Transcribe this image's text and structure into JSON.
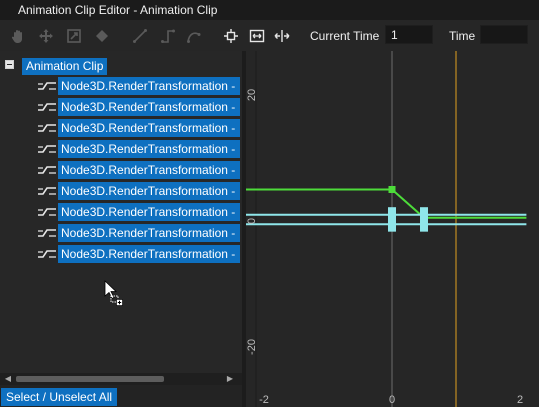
{
  "window": {
    "title": "Animation Clip Editor - Animation Clip"
  },
  "toolbar": {
    "tools": [
      {
        "icon": "hand-pan-icon",
        "enabled": false
      },
      {
        "icon": "move-icon",
        "enabled": false
      },
      {
        "icon": "scale-icon",
        "enabled": false
      },
      {
        "icon": "keyframe-diamond-icon",
        "enabled": false
      },
      {
        "icon": "linear-tangent-icon",
        "enabled": false
      },
      {
        "icon": "step-tangent-icon",
        "enabled": false
      },
      {
        "icon": "smooth-tangent-icon",
        "enabled": false
      },
      {
        "icon": "frame-selection-icon",
        "enabled": true
      },
      {
        "icon": "fit-all-icon",
        "enabled": true
      },
      {
        "icon": "fit-horizontal-icon",
        "enabled": true
      }
    ],
    "current_time_label": "Current Time",
    "current_time_value": "1",
    "time_label": "Time",
    "time_value": ""
  },
  "tree": {
    "root": {
      "label": "Animation Clip",
      "expanded": true
    },
    "items": [
      {
        "label": "Node3D.RenderTransformation - "
      },
      {
        "label": "Node3D.RenderTransformation - "
      },
      {
        "label": "Node3D.RenderTransformation - "
      },
      {
        "label": "Node3D.RenderTransformation - "
      },
      {
        "label": "Node3D.RenderTransformation - "
      },
      {
        "label": "Node3D.RenderTransformation - "
      },
      {
        "label": "Node3D.RenderTransformation - "
      },
      {
        "label": "Node3D.RenderTransformation - "
      },
      {
        "label": "Node3D.RenderTransformation - "
      }
    ]
  },
  "scrollbar": {
    "left_arrow": "◀",
    "right_arrow": "▶"
  },
  "footer": {
    "select_label": "Select / Unselect All"
  },
  "colors": {
    "selection": "#0e70c0",
    "green_curve": "#4ddc3a",
    "cyan_curve": "#8fe6ea",
    "current_time_line": "#e0a020",
    "zero_line": "#555555"
  },
  "chart_data": {
    "type": "line",
    "x_ticks": [
      "-2",
      "0",
      "2"
    ],
    "y_ticks": [
      "20",
      "0",
      "-20"
    ],
    "xlim": [
      -2.3,
      2.1
    ],
    "ylim": [
      -24,
      24
    ],
    "current_time": 1,
    "series": [
      {
        "color": "#4ddc3a",
        "points": [
          [
            -2.3,
            5
          ],
          [
            0,
            5
          ],
          [
            0.5,
            0.5
          ],
          [
            2.1,
            0.5
          ]
        ],
        "keys": [
          [
            0,
            5
          ]
        ]
      },
      {
        "color": "#8fe6ea",
        "points": [
          [
            -2.3,
            1
          ],
          [
            2.1,
            1
          ]
        ],
        "keys": [
          [
            0,
            1
          ],
          [
            0.5,
            1
          ]
        ]
      },
      {
        "color": "#8fe6ea",
        "points": [
          [
            -2.3,
            -0.5
          ],
          [
            2.1,
            -0.5
          ]
        ],
        "keys": [
          [
            0,
            -0.5
          ],
          [
            0.5,
            -0.5
          ]
        ]
      }
    ]
  }
}
